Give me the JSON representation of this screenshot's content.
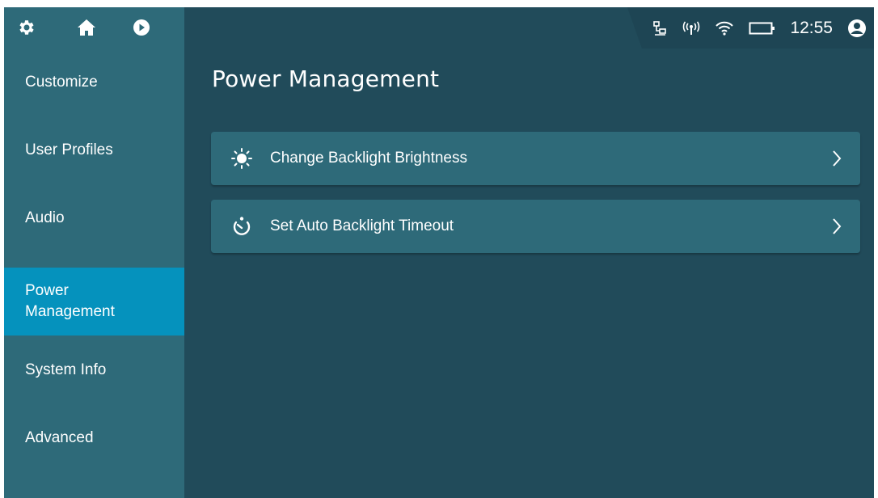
{
  "topbar": {
    "nav_icons": [
      "gear-icon",
      "home-icon",
      "play-circle-icon"
    ],
    "status_icons": [
      "network-icon",
      "antenna-icon",
      "wifi-icon",
      "battery-icon",
      "user-icon"
    ],
    "time": "12:55"
  },
  "sidebar": {
    "items": [
      {
        "label": "Customize",
        "active": false
      },
      {
        "label": "User Profiles",
        "active": false
      },
      {
        "label": "Audio",
        "active": false
      },
      {
        "label": "Power\nManagement",
        "active": true
      },
      {
        "label": "System Info",
        "active": false
      },
      {
        "label": "Advanced",
        "active": false
      }
    ]
  },
  "main": {
    "title": "Power Management",
    "options": [
      {
        "label": "Change Backlight Brightness",
        "icon": "sun-icon"
      },
      {
        "label": "Set Auto Backlight Timeout",
        "icon": "timer-icon"
      }
    ]
  },
  "colors": {
    "background": "#214b5a",
    "panel": "#2e6a79",
    "active": "#0592bd",
    "text": "#ffffff"
  }
}
